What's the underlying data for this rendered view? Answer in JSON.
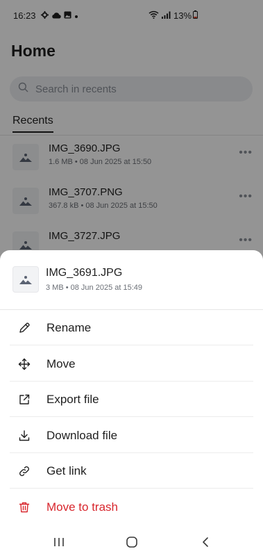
{
  "status_bar": {
    "time": "16:23",
    "battery": "13%",
    "left_icons": [
      "settings-icon",
      "cloud-icon",
      "gallery-icon",
      "dot-icon"
    ],
    "right_icons": [
      "wifi-icon",
      "signal-icon"
    ]
  },
  "page": {
    "title": "Home"
  },
  "search": {
    "placeholder": "Search in recents"
  },
  "tabs": [
    {
      "label": "Recents",
      "active": true
    }
  ],
  "files": [
    {
      "name": "IMG_3690.JPG",
      "meta": "1.6 MB • 08 Jun 2025 at 15:50",
      "icon": "image-icon"
    },
    {
      "name": "IMG_3707.PNG",
      "meta": "367.8 kB • 08 Jun 2025 at 15:50",
      "icon": "image-icon"
    },
    {
      "name": "IMG_3727.JPG",
      "meta": "",
      "icon": "image-icon"
    }
  ],
  "sheet": {
    "file": {
      "name": "IMG_3691.JPG",
      "meta": "3 MB • 08 Jun 2025 at 15:49",
      "icon": "image-icon"
    },
    "actions": [
      {
        "label": "Rename",
        "icon": "pencil-icon"
      },
      {
        "label": "Move",
        "icon": "move-arrows-icon"
      },
      {
        "label": "Export file",
        "icon": "export-icon"
      },
      {
        "label": "Download file",
        "icon": "download-icon"
      },
      {
        "label": "Get link",
        "icon": "link-icon"
      },
      {
        "label": "Move to trash",
        "icon": "trash-icon",
        "danger": true
      }
    ]
  },
  "navbar": {
    "buttons": [
      "recents-nav-icon",
      "home-nav-icon",
      "back-nav-icon"
    ]
  },
  "colors": {
    "danger": "#d8262d",
    "overlay": "rgba(0,0,0,0.42)",
    "thumb_bg": "#f2f3f5"
  }
}
